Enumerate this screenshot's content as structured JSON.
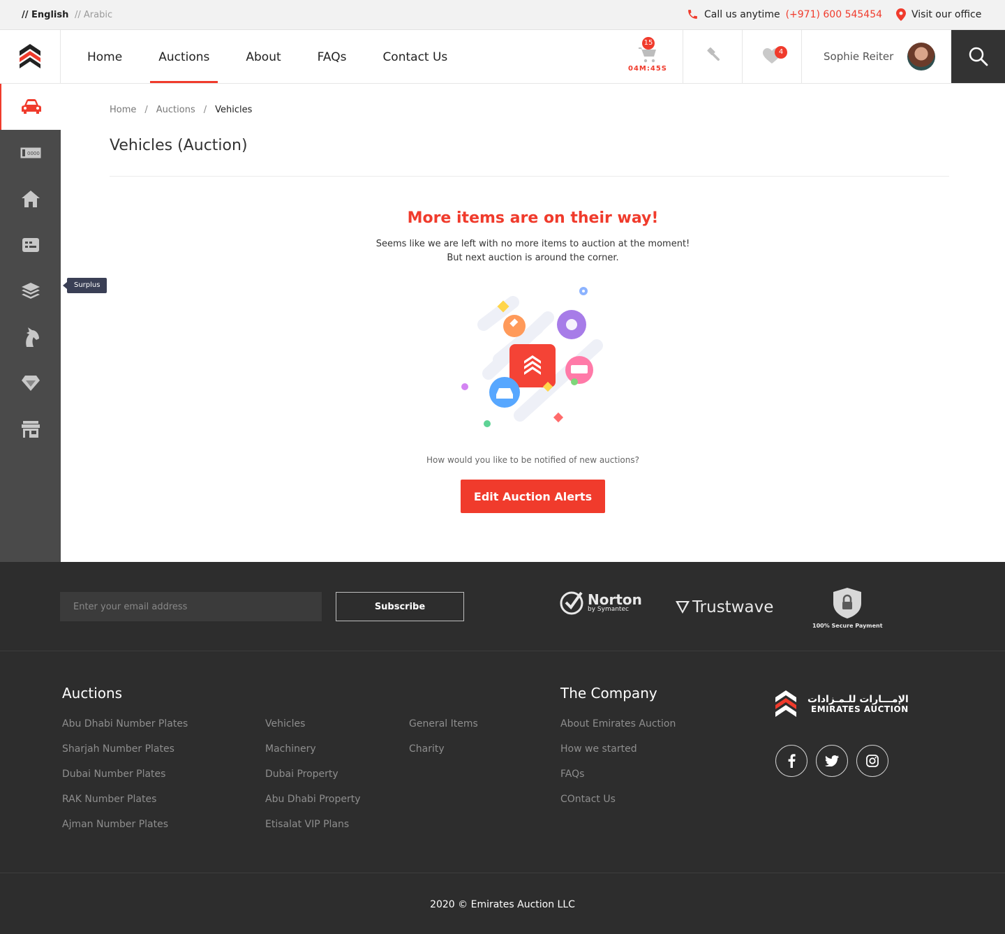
{
  "topbar": {
    "lang_english": "// English",
    "lang_arabic": "// Arabic",
    "call_label": "Call us anytime",
    "call_number": "(+971) 600 545454",
    "visit_label": "Visit our office"
  },
  "nav": {
    "items": [
      "Home",
      "Auctions",
      "About",
      "FAQs",
      "Contact Us"
    ],
    "active": "Auctions"
  },
  "header": {
    "cart_count": "15",
    "timer": "04M:45S",
    "favorites_count": "4",
    "user_name": "Sophie Reiter"
  },
  "sidebar": {
    "items": [
      "car-icon",
      "number-plate-icon",
      "property-icon",
      "vip-plans-icon",
      "surplus-layers-icon",
      "horse-icon",
      "diamond-icon",
      "store-icon"
    ],
    "tooltip": "Surplus"
  },
  "breadcrumb": {
    "home": "Home",
    "auctions": "Auctions",
    "current": "Vehicles"
  },
  "page": {
    "title": "Vehicles (Auction)",
    "empty_title": "More items are on their way!",
    "empty_line1": "Seems like we are left with no more items to auction at the moment!",
    "empty_line2": "But next auction is around the corner.",
    "notify_question": "How would you like to be notified of new auctions?",
    "cta_label": "Edit Auction Alerts"
  },
  "footer": {
    "email_placeholder": "Enter your email address",
    "subscribe_label": "Subscribe",
    "norton_name": "Norton",
    "norton_sub": "by Symantec",
    "trustwave": "Trustwave",
    "secure_payment": "100% Secure Payment",
    "auctions_heading": "Auctions",
    "auctions_col1": [
      "Abu Dhabi Number Plates",
      "Sharjah Number Plates",
      "Dubai Number Plates",
      "RAK Number Plates",
      "Ajman Number Plates"
    ],
    "auctions_col2": [
      "Vehicles",
      "Machinery",
      "Dubai Property",
      "Abu Dhabi Property",
      "Etisalat VIP Plans"
    ],
    "auctions_col3": [
      "General Items",
      "Charity"
    ],
    "company_heading": "The Company",
    "company_links": [
      "About Emirates Auction",
      "How we started",
      "FAQs",
      "COntact Us"
    ],
    "brand_arabic": "الإمـــارات للـمـزادات",
    "brand_english": "EMIRATES AUCTION",
    "copyright": "2020 © Emirates Auction LLC"
  },
  "colors": {
    "accent": "#f03b2c",
    "sidebar": "#4a4a4a",
    "footer": "#2d2d2d"
  }
}
